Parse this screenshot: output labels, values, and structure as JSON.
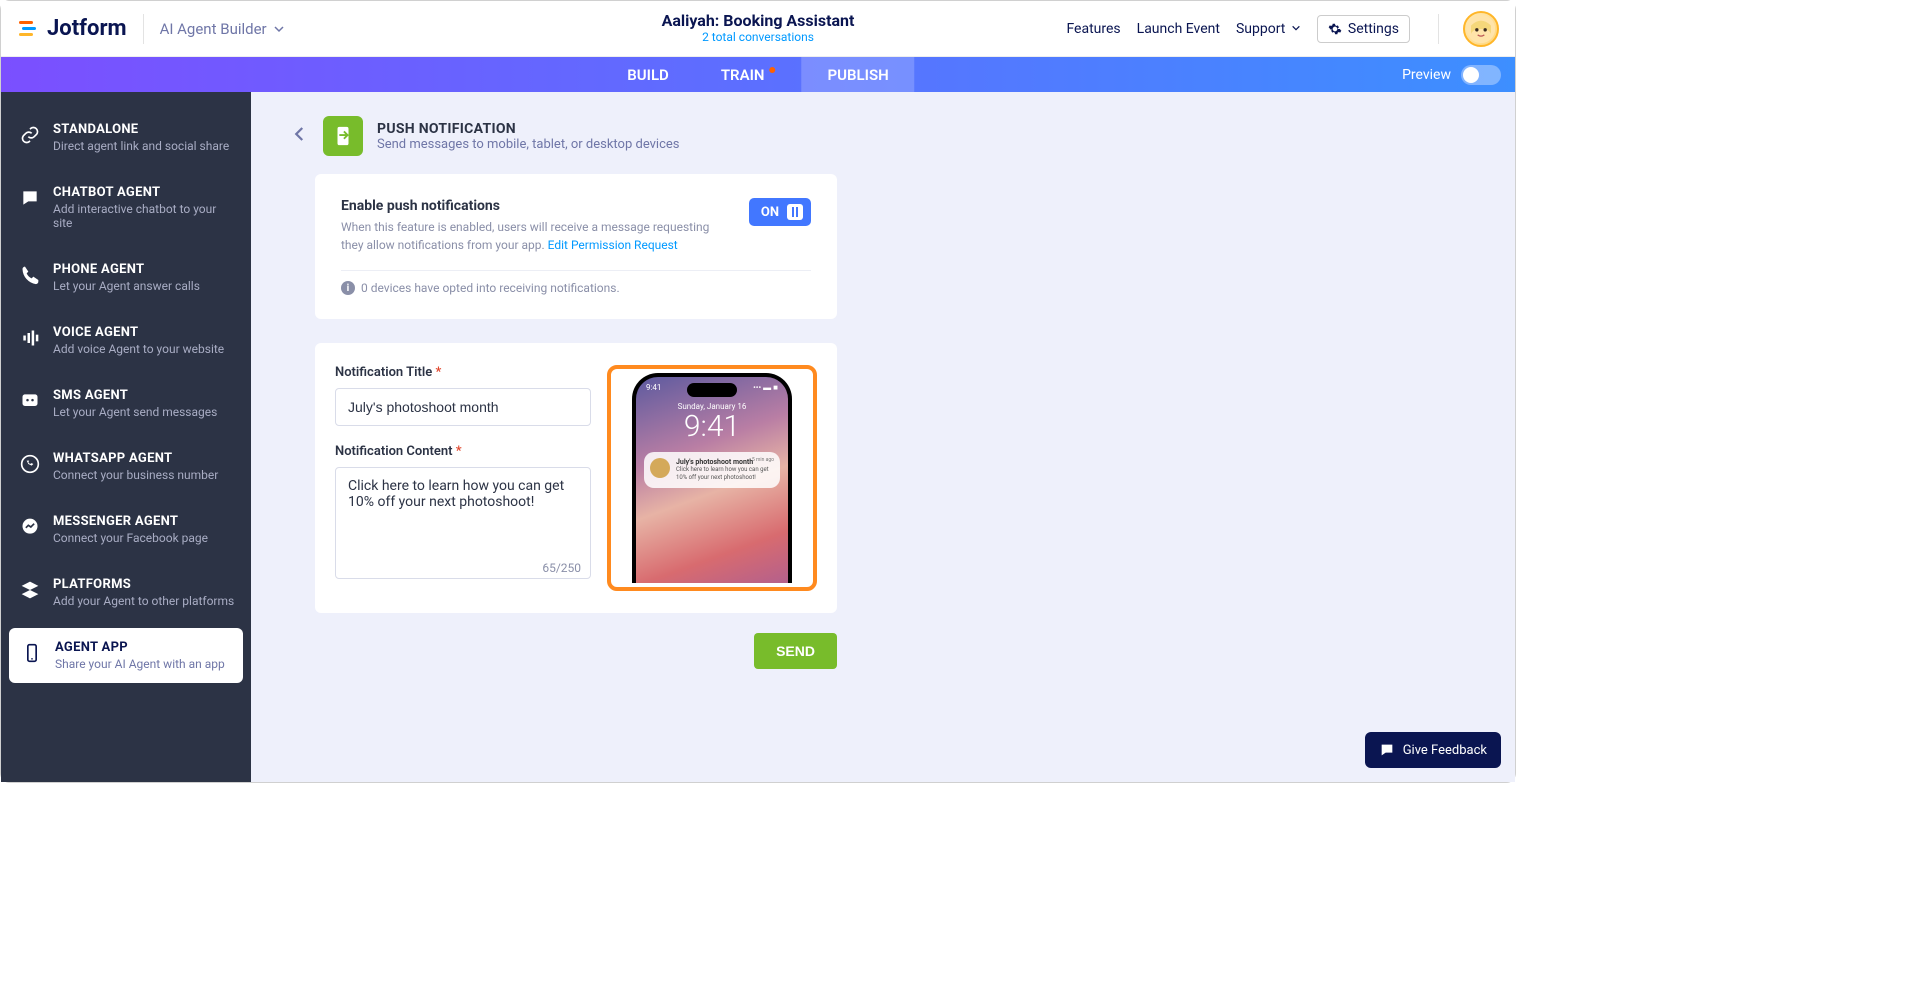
{
  "header": {
    "brand": "Jotform",
    "breadcrumb": "AI Agent Builder",
    "title": "Aaliyah: Booking Assistant",
    "subtitle": "2 total conversations",
    "links": {
      "features": "Features",
      "launch": "Launch Event",
      "support": "Support"
    },
    "settings": "Settings"
  },
  "tabs": {
    "build": "BUILD",
    "train": "TRAIN",
    "publish": "PUBLISH",
    "preview": "Preview"
  },
  "sidebar": {
    "items": [
      {
        "title": "STANDALONE",
        "desc": "Direct agent link and social share"
      },
      {
        "title": "CHATBOT AGENT",
        "desc": "Add interactive chatbot to your site"
      },
      {
        "title": "PHONE AGENT",
        "desc": "Let your Agent answer calls"
      },
      {
        "title": "VOICE AGENT",
        "desc": "Add voice Agent to your website"
      },
      {
        "title": "SMS AGENT",
        "desc": "Let your Agent send messages"
      },
      {
        "title": "WHATSAPP AGENT",
        "desc": "Connect your business number"
      },
      {
        "title": "MESSENGER AGENT",
        "desc": "Connect your Facebook page"
      },
      {
        "title": "PLATFORMS",
        "desc": "Add your Agent to other platforms"
      },
      {
        "title": "AGENT APP",
        "desc": "Share your AI Agent with an app"
      }
    ]
  },
  "page": {
    "title": "PUSH NOTIFICATION",
    "subtitle": "Send messages to mobile, tablet, or desktop devices"
  },
  "enable": {
    "title": "Enable push notifications",
    "desc": "When this feature is enabled, users will receive a message requesting they allow notifications from your app. ",
    "link": "Edit Permission Request",
    "state": "ON",
    "info": "0 devices have opted into receiving notifications."
  },
  "form": {
    "title_label": "Notification Title",
    "title_value": "July's photoshoot month",
    "content_label": "Notification Content",
    "content_value": "Click here to learn how you can get 10% off your next photoshoot!",
    "counter": "65/250",
    "send": "SEND"
  },
  "phone": {
    "time": "9:41",
    "date": "Sunday, January 16",
    "clock": "9:41",
    "ago": "5 min ago",
    "ntitle": "July's photoshoot month",
    "ncontent": "Click here to learn how you can get 10% off your next photoshoot!"
  },
  "feedback": "Give Feedback"
}
